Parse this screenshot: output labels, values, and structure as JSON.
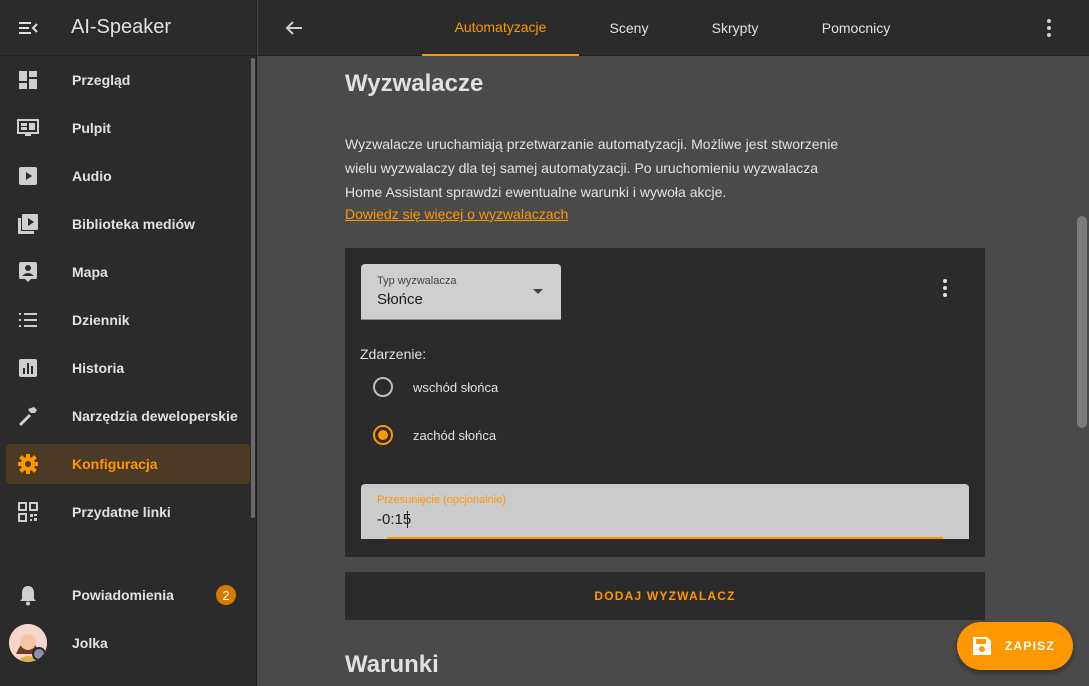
{
  "sidebar": {
    "title": "AI-Speaker",
    "items": [
      {
        "label": "Przegląd",
        "icon": "dashboard-icon"
      },
      {
        "label": "Pulpit",
        "icon": "monitor-dashboard-icon"
      },
      {
        "label": "Audio",
        "icon": "play-box-icon"
      },
      {
        "label": "Biblioteka mediów",
        "icon": "media-library-icon"
      },
      {
        "label": "Mapa",
        "icon": "account-box-icon"
      },
      {
        "label": "Dziennik",
        "icon": "format-list-icon"
      },
      {
        "label": "Historia",
        "icon": "chart-box-icon"
      },
      {
        "label": "Narzędzia deweloperskie",
        "icon": "hammer-icon"
      },
      {
        "label": "Konfiguracja",
        "icon": "gear-icon",
        "active": true
      },
      {
        "label": "Przydatne linki",
        "icon": "qrcode-icon"
      }
    ],
    "notifications": {
      "label": "Powiadomienia",
      "count": "2"
    },
    "user": {
      "label": "Jolka"
    }
  },
  "topbar": {
    "tabs": [
      {
        "label": "Automatyzacje",
        "active": true
      },
      {
        "label": "Sceny"
      },
      {
        "label": "Skrypty"
      },
      {
        "label": "Pomocnicy"
      }
    ]
  },
  "triggers": {
    "title": "Wyzwalacze",
    "description_lines": [
      "Wyzwalacze uruchamiają przetwarzanie automatyzacji. Możliwe jest stworzenie",
      "wielu wyzwalaczy dla tej samej automatyzacji. Po uruchomieniu wyzwalacza",
      "Home Assistant sprawdzi ewentualne warunki i wywoła akcje."
    ],
    "learn_more": "Dowiedz się więcej o wyzwalaczach",
    "card": {
      "type_label": "Typ wyzwalacza",
      "type_value": "Słońce",
      "event_label": "Zdarzenie:",
      "options": [
        {
          "label": "wschód słońca",
          "checked": false
        },
        {
          "label": "zachód słońca",
          "checked": true
        }
      ],
      "offset_label": "Przesunięcie (opcjonalnie)",
      "offset_value": "-0:15"
    },
    "add_button": "DODAJ WYZWALACZ"
  },
  "conditions": {
    "title": "Warunki"
  },
  "fab": {
    "label": "ZAPISZ",
    "icon": "save-icon"
  },
  "colors": {
    "accent": "#ff9800",
    "sidebar_bg": "#2b2b2b",
    "main_bg": "#4a4a4a"
  }
}
